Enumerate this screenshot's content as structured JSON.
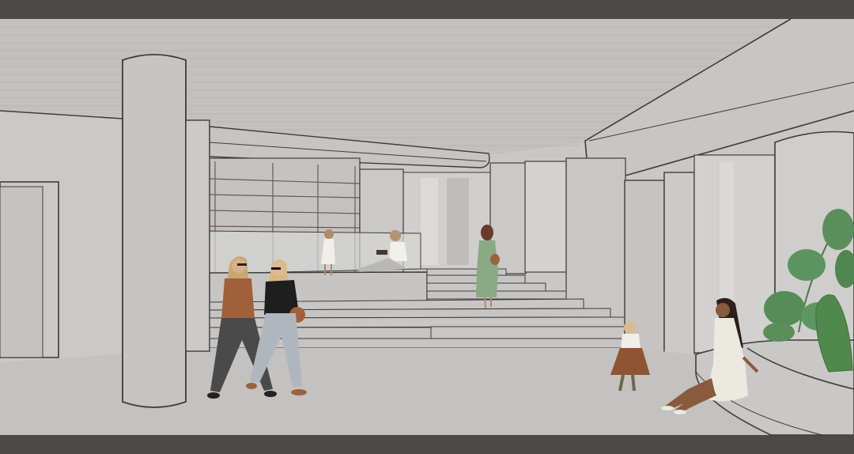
{
  "image": {
    "kind": "architectural-interior-rendering",
    "colors": {
      "frame_bar": "#4b4a48",
      "wall": "#c9c8c6",
      "ceiling": "#c2c1bf",
      "floor": "#c3c2c0",
      "column": "#c6c5c3",
      "glass": "#d4d3d1",
      "outline": "#3f3c39",
      "plant_green": "#5a8f5c",
      "cactus_green": "#4f8a4c",
      "cardigan_brown": "#a0613a",
      "dress_green": "#8aa985",
      "dress_cream": "#ece9e0"
    },
    "figures": [
      "woman-brown-cardigan",
      "woman-black-top-sunglasses",
      "woman-green-dress-on-stairs",
      "child-seated-white-dress",
      "woman-reading-on-platform",
      "girl-brown-pinafore",
      "woman-seated-cream-dress"
    ],
    "plants": [
      "monstera-plant",
      "cactus-plant"
    ]
  }
}
